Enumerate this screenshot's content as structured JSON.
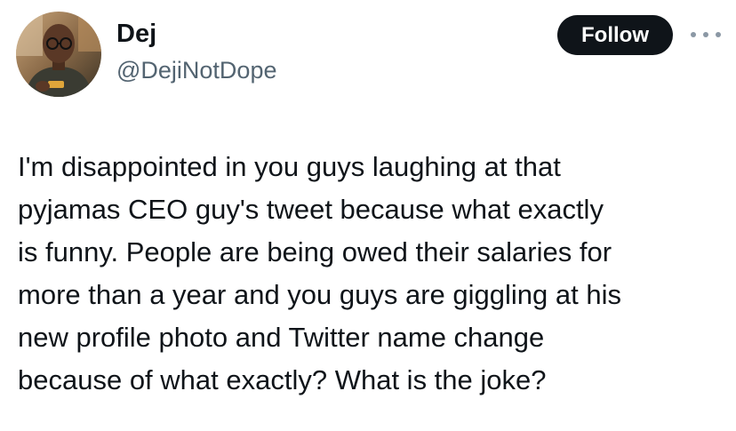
{
  "author": {
    "display_name": "Dej",
    "handle": "@DejiNotDope"
  },
  "actions": {
    "follow_label": "Follow",
    "more_icon": "more-horizontal-icon"
  },
  "tweet": {
    "lines": [
      "I'm disappointed in you guys laughing at that",
      "pyjamas CEO guy's tweet because what exactly",
      "is funny. People are being owed their salaries for",
      "more than a year and you guys are giggling at his",
      "new profile photo and Twitter name change",
      "because of what exactly? What is the joke?"
    ]
  },
  "colors": {
    "text_primary": "#0f1419",
    "text_secondary": "#536471",
    "follow_bg": "#0f1419",
    "follow_text": "#ffffff"
  }
}
